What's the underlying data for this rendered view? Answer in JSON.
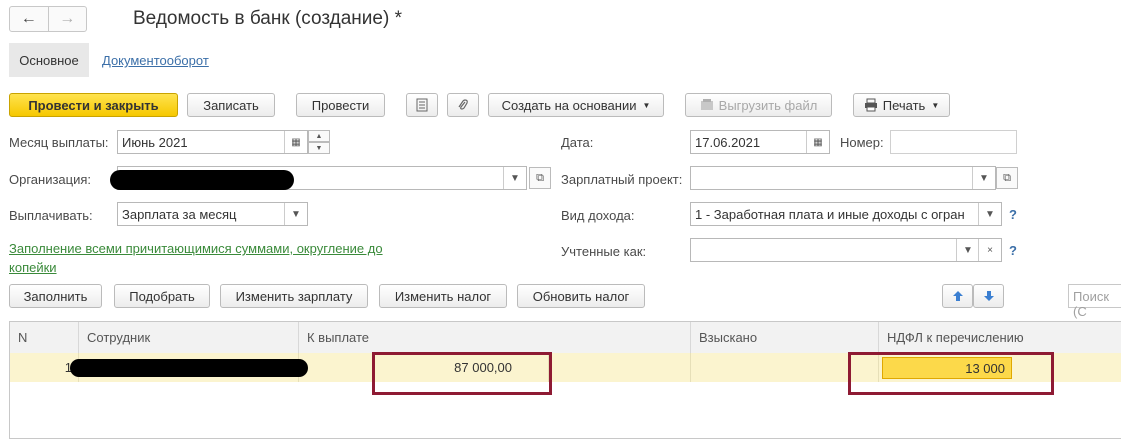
{
  "window": {
    "title": "Ведомость в банк (создание) *",
    "nav": {
      "back": "←",
      "forward": "→"
    }
  },
  "tabs": [
    {
      "label": "Основное"
    },
    {
      "label": "Документооборот"
    }
  ],
  "toolbar": {
    "post_close": "Провести и закрыть",
    "save": "Записать",
    "post": "Провести",
    "create_based": "Создать на основании",
    "export": "Выгрузить файл",
    "print": "Печать"
  },
  "form": {
    "month_label": "Месяц выплаты:",
    "month_value": "Июнь 2021",
    "date_label": "Дата:",
    "date_value": "17.06.2021",
    "number_label": "Номер:",
    "number_value": "",
    "org_label": "Организация:",
    "salary_project_label": "Зарплатный проект:",
    "salary_project_value": "",
    "pay_label": "Выплачивать:",
    "pay_value": "Зарплата за месяц",
    "income_type_label": "Вид дохода:",
    "income_type_value": "1 - Заработная плата и иные доходы с огран",
    "counted_label": "Учтенные как:",
    "counted_value": "",
    "fill_link": "Заполнение всеми причитающимися суммами, округление до копейки"
  },
  "table_toolbar": {
    "fill": "Заполнить",
    "pick": "Подобрать",
    "change_salary": "Изменить зарплату",
    "change_tax": "Изменить налог",
    "refresh_tax": "Обновить налог",
    "search_placeholder": "Поиск (С"
  },
  "table": {
    "columns": [
      "N",
      "Сотрудник",
      "К выплате",
      "Взыскано",
      "НДФЛ к перечислению"
    ],
    "rows": [
      {
        "n": "1",
        "employee": "",
        "to_pay": "87 000,00",
        "collected": "",
        "ndfl": "13 000"
      }
    ]
  },
  "colors": {
    "accent_yellow": "#f6c800",
    "highlight_red": "#8e1a33",
    "row_bg": "#fbf4cf",
    "link_green": "#3a8a3a"
  }
}
